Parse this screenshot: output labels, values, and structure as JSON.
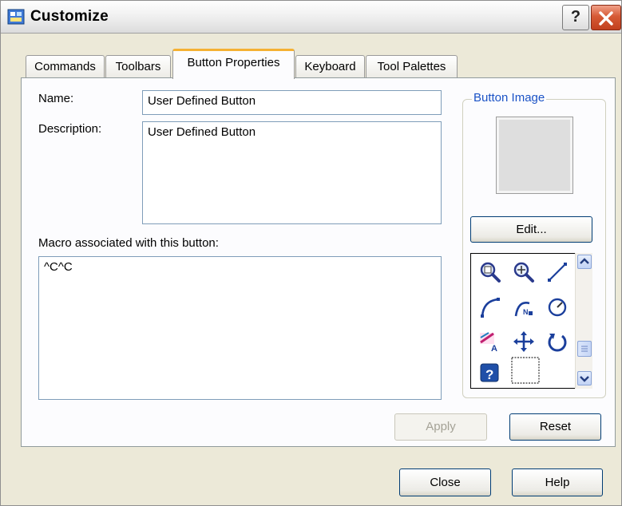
{
  "window": {
    "title": "Customize",
    "help_glyph": "?"
  },
  "tabs": [
    "Commands",
    "Toolbars",
    "Button Properties",
    "Keyboard",
    "Tool Palettes"
  ],
  "active_tab": "Button Properties",
  "fields": {
    "name_label": "Name:",
    "name_value": "User Defined Button",
    "description_label": "Description:",
    "description_value": "User Defined Button",
    "macro_label": "Macro associated with this button:",
    "macro_value": "^C^C"
  },
  "button_image": {
    "group_title": "Button Image",
    "edit_label": "Edit...",
    "icons": [
      "zoom-window-icon",
      "zoom-realtime-icon",
      "line-icon",
      "arc-icon",
      "arc-2-icon",
      "circle-icon",
      "text-style-icon",
      "move-icon",
      "rotate-icon",
      "help-icon",
      "blank-icon"
    ]
  },
  "buttons": {
    "apply": "Apply",
    "reset": "Reset",
    "close": "Close",
    "help": "Help"
  },
  "colors": {
    "accent": "#1a52c6",
    "tab_highlight": "#f5b133",
    "close_button": "#d65a35"
  }
}
